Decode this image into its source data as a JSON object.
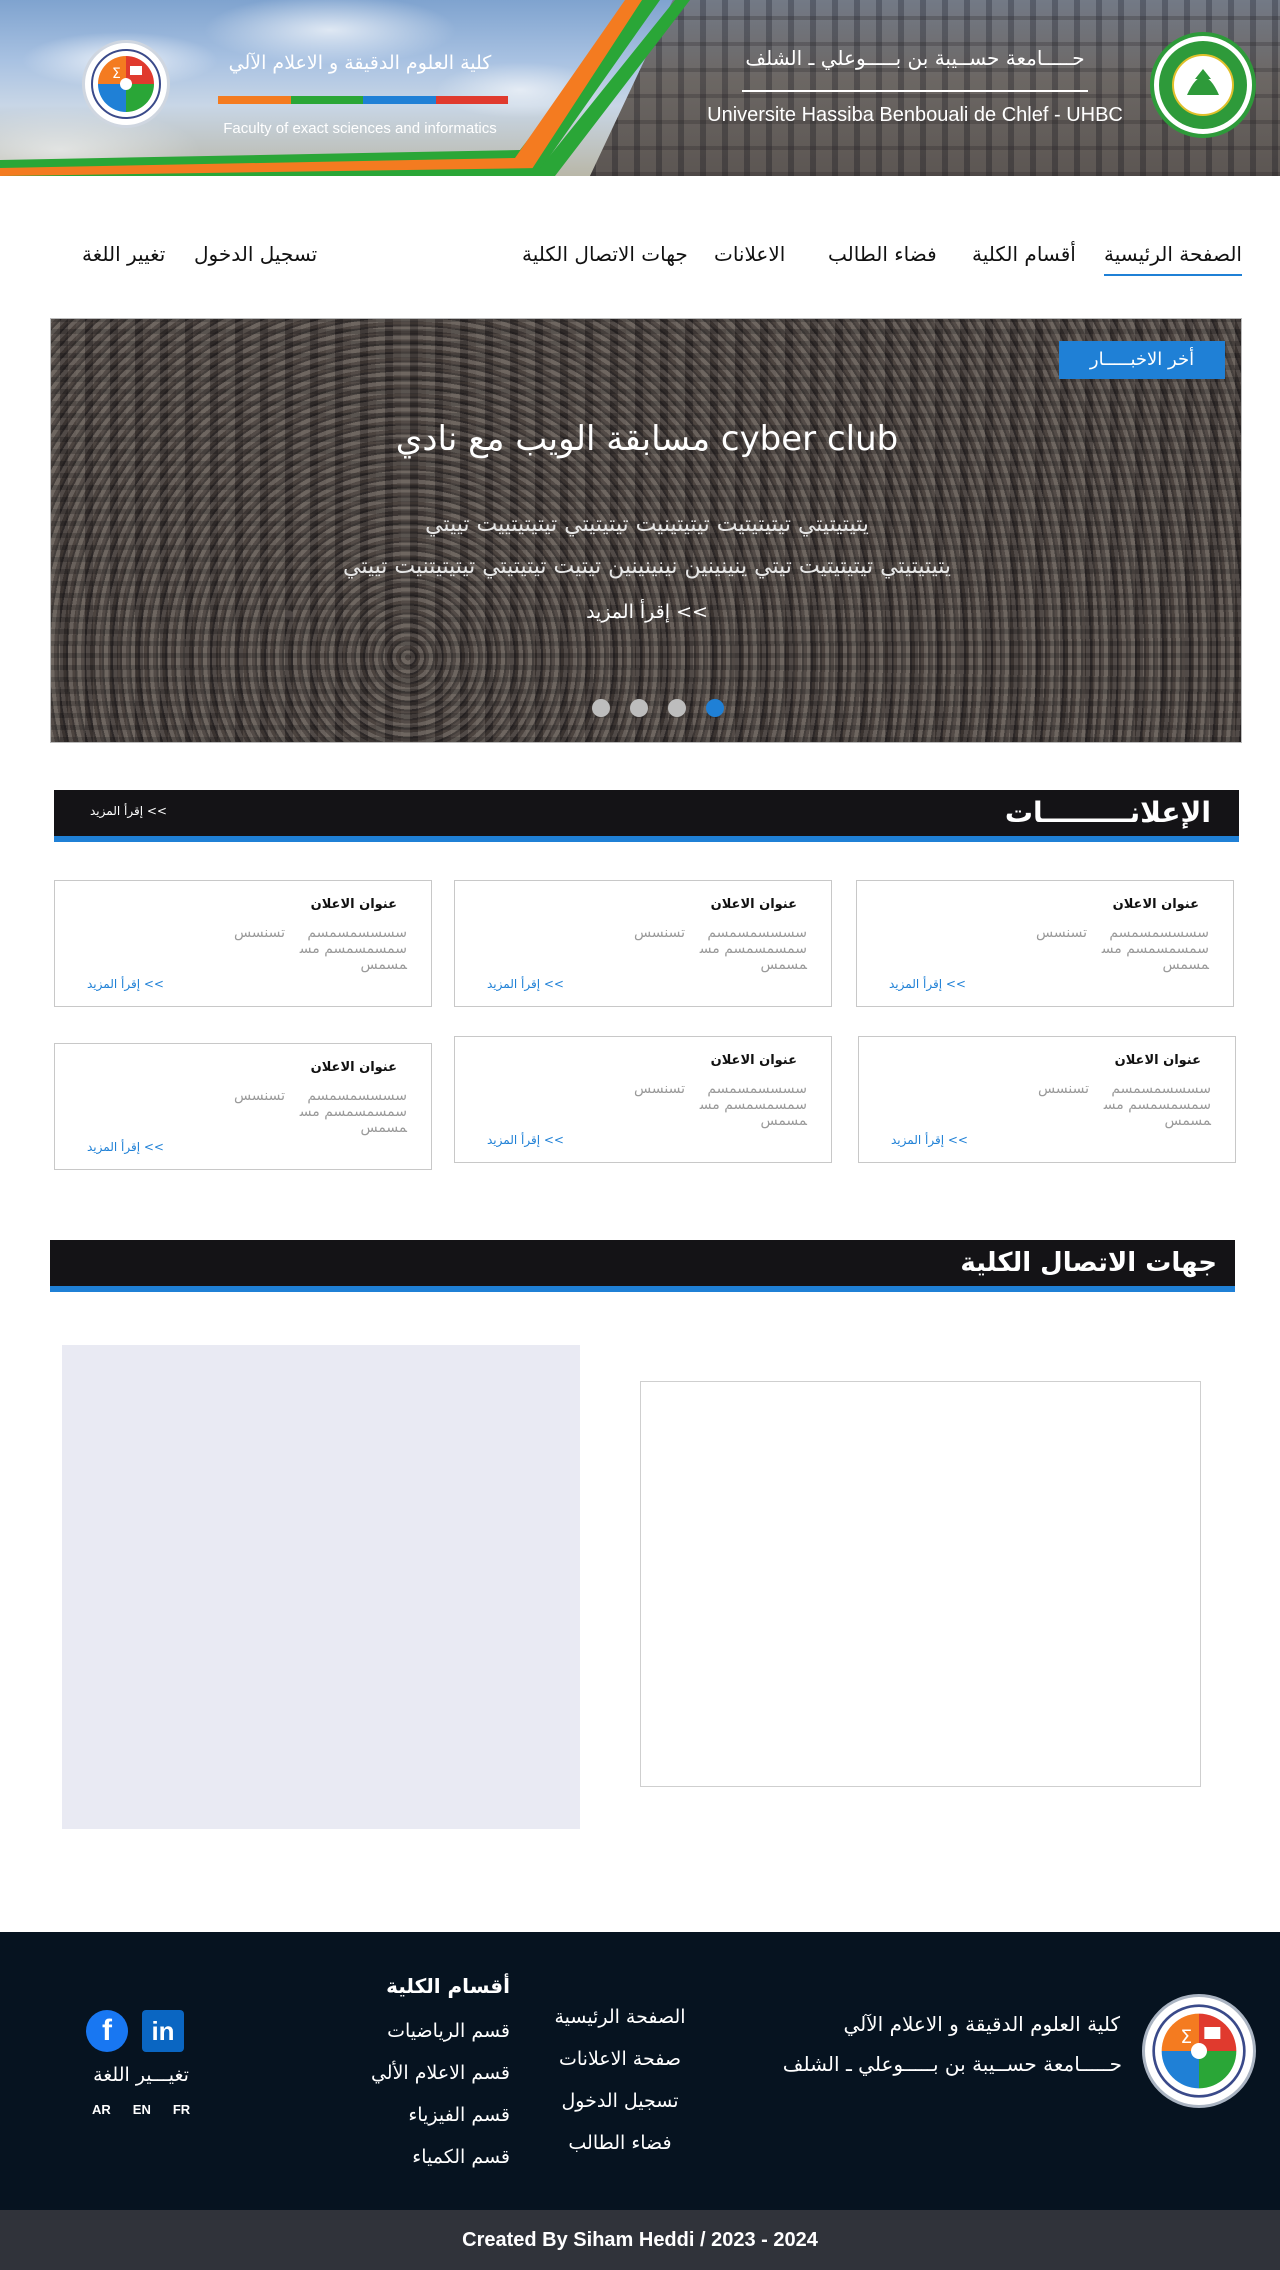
{
  "header": {
    "faculty_title": "كلية العلوم الدقيقة و الاعلام الآلي",
    "faculty_subtitle": "Faculty of exact sciences and informatics",
    "faculty_bar_colors": [
      "#f47b20",
      "#2aa637",
      "#1f80d6",
      "#e03a2e"
    ],
    "university_ar": "حـــــامعة حســيبة بن بـــــوعلي ـ الشلف",
    "university_fr": "Universite Hassiba Benbouali de Chlef - UHBC",
    "stripe_colors": [
      "#2aa637",
      "#f47b20",
      "#1f80d6"
    ]
  },
  "nav": {
    "items": [
      {
        "label": "الصفحة الرئيسية",
        "active": true
      },
      {
        "label": "أقسام الكلية"
      },
      {
        "label": "فضاء الطالب"
      },
      {
        "label": "الاعلانات"
      },
      {
        "label": "جهات الاتصال الكلية"
      },
      {
        "label": "تسجيل الدخول"
      },
      {
        "label": "تغيير اللغة"
      }
    ]
  },
  "slider": {
    "badge": "أخر الاخبـــــار",
    "title": "مسابقة الويب مع نادي cyber club",
    "line1": "يتيتيتيتي تيتيتيتيت تيتيتينيت تيتيتيتي تيتيتيتييت تييتي",
    "line2": "يتيتيتيتي تيتيتيتيت تيتي ينينينين نينينينين تيتيت تيتيتيتي تيتيتيتنيت تييتي",
    "more": "إقرأ المزيد <<",
    "active_dot": 3,
    "dot_count": 4
  },
  "announcements": {
    "title": "الإعلانـــــــــات",
    "more": "إقرأ المزيد <<",
    "cards": [
      {
        "title": "عنوان الاعلان",
        "body": "سسسسمسمسم سمسمسمسم مسمسمس",
        "extra": "تسنسس",
        "more": "إقرأ المزيد <<"
      },
      {
        "title": "عنوان الاعلان",
        "body": "سسسسمسمسم سمسمسمسم مسمسمس",
        "extra": "تسنسس",
        "more": "إقرأ المزيد <<"
      },
      {
        "title": "عنوان الاعلان",
        "body": "سسسسمسمسم سمسمسمسم مسمسمس",
        "extra": "تسنسس",
        "more": "إقرأ المزيد <<"
      },
      {
        "title": "عنوان الاعلان",
        "body": "سسسسمسمسم سمسمسمسم مسمسمس",
        "extra": "تسنسس",
        "more": "إقرأ المزيد <<"
      },
      {
        "title": "عنوان الاعلان",
        "body": "سسسسمسمسم سمسمسمسم مسمسمس",
        "extra": "تسنسس",
        "more": "إقرأ المزيد <<"
      },
      {
        "title": "عنوان الاعلان",
        "body": "سسسسمسمسم سمسمسمسم مسمسمس",
        "extra": "تسنسس",
        "more": "إقرأ المزيد <<"
      }
    ]
  },
  "contact": {
    "title": "جهات الاتصال الكلية"
  },
  "footer": {
    "faculty": "كلية العلوم الدقيقة و الاعلام الآلي",
    "university": "حـــــامعة حســيبة بن بـــــوعلي ـ الشلف",
    "links": [
      "الصفحة الرئيسية",
      "صفحة الاعلانات",
      "تسجيل الدخول",
      "فضاء الطالب"
    ],
    "departments_title": "أقسام الكلية",
    "departments": [
      "قسم الرياضيات",
      "قسم الاعلام الألي",
      "قسم الفيزياء",
      "قسم الكمياء"
    ],
    "language_label": "تغيـــير اللغة",
    "languages": [
      "AR",
      "EN",
      "FR"
    ],
    "social_icons": [
      "facebook-icon",
      "linkedin-icon"
    ]
  },
  "copyright": "Created By Siham Heddi / 2023 - 2024"
}
